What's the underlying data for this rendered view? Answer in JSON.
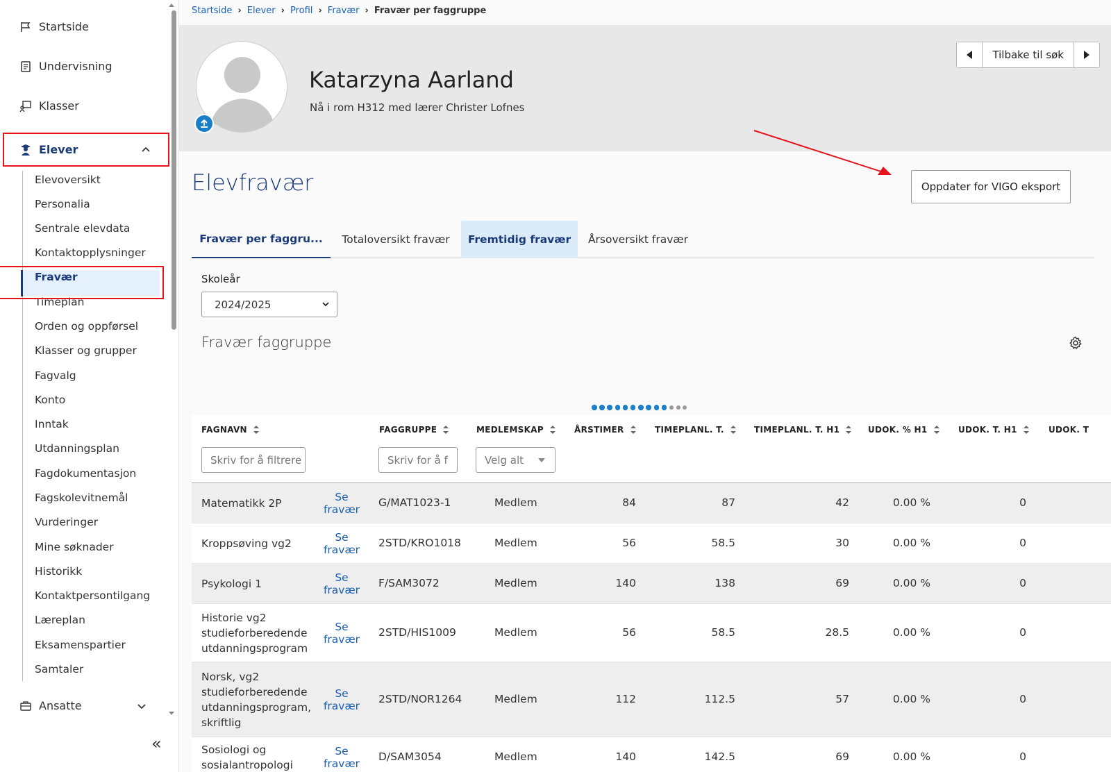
{
  "sidebar": {
    "main_items": [
      {
        "label": "Startside",
        "icon": "flag-icon"
      },
      {
        "label": "Undervisning",
        "icon": "book-icon"
      },
      {
        "label": "Klasser",
        "icon": "classroom-icon"
      },
      {
        "label": "Elever",
        "icon": "student-icon"
      },
      {
        "label": "Ansatte",
        "icon": "briefcase-icon"
      }
    ],
    "sub_items": [
      "Elevoversikt",
      "Personalia",
      "Sentrale elevdata",
      "Kontaktopplysninger",
      "Fravær",
      "Timeplan",
      "Orden og oppførsel",
      "Klasser og grupper",
      "Fagvalg",
      "Konto",
      "Inntak",
      "Utdanningsplan",
      "Fagdokumentasjon",
      "Fagskolevitnemål",
      "Vurderinger",
      "Mine søknader",
      "Historikk",
      "Kontaktpersontilgang",
      "Læreplan",
      "Eksamenspartier",
      "Samtaler"
    ],
    "active_sub_item": "Fravær",
    "collapse_glyph": "«"
  },
  "breadcrumb": [
    "Startside",
    "Elever",
    "Profil",
    "Fravær",
    "Fravær per faggruppe"
  ],
  "student": {
    "name": "Katarzyna Aarland",
    "subtitle": "Nå i rom H312 med lærer Christer Lofnes"
  },
  "header_nav": {
    "back_label": "Tilbake til søk"
  },
  "page": {
    "title": "Elevfravær",
    "vigo_button": "Oppdater for VIGO eksport",
    "tabs": [
      "Fravær per faggru...",
      "Totaloversikt fravær",
      "Fremtidig fravær",
      "Årsoversikt fravær"
    ],
    "active_tab": "Fravær per faggru...",
    "highlighted_tab": "Fremtidig fravær",
    "schoolyear_label": "Skoleår",
    "schoolyear_value": "2024/2025",
    "section_title": "Fravær faggruppe",
    "pager_dots_active": 10,
    "pager_dots_inactive": 3
  },
  "table": {
    "headers": [
      "FAGNAVN",
      "FAGGRUPPE",
      "MEDLEMSKAP",
      "ÅRSTIMER",
      "TIMEPLANL. T.",
      "TIMEPLANL. T. H1",
      "UDOK. % H1",
      "UDOK. T. H1",
      "UDOK. T"
    ],
    "filters": {
      "fagnavn_placeholder": "Skriv for å filtrere",
      "faggruppe_placeholder": "Skriv for å f",
      "medlemskap_placeholder": "Velg alt"
    },
    "rows": [
      {
        "fagnavn": "Matematikk 2P",
        "link": "Se fravær",
        "faggruppe": "G/MAT1023-1",
        "medlemskap": "Medlem",
        "arstimer": "84",
        "timeplanl": "87",
        "timeplanl_h1": "42",
        "udok_pct_h1": "0.00 %",
        "udok_t_h1": "0"
      },
      {
        "fagnavn": "Kroppsøving vg2",
        "link": "Se fravær",
        "faggruppe": "2STD/KRO1018",
        "medlemskap": "Medlem",
        "arstimer": "56",
        "timeplanl": "58.5",
        "timeplanl_h1": "30",
        "udok_pct_h1": "0.00 %",
        "udok_t_h1": "0"
      },
      {
        "fagnavn": "Psykologi 1",
        "link": "Se fravær",
        "faggruppe": "F/SAM3072",
        "medlemskap": "Medlem",
        "arstimer": "140",
        "timeplanl": "138",
        "timeplanl_h1": "69",
        "udok_pct_h1": "0.00 %",
        "udok_t_h1": "0"
      },
      {
        "fagnavn": "Historie vg2 studieforberedende utdanningsprogram",
        "link": "Se fravær",
        "faggruppe": "2STD/HIS1009",
        "medlemskap": "Medlem",
        "arstimer": "56",
        "timeplanl": "58.5",
        "timeplanl_h1": "28.5",
        "udok_pct_h1": "0.00 %",
        "udok_t_h1": "0"
      },
      {
        "fagnavn": "Norsk, vg2 studieforberedende utdanningsprogram, skriftlig",
        "link": "Se fravær",
        "faggruppe": "2STD/NOR1264",
        "medlemskap": "Medlem",
        "arstimer": "112",
        "timeplanl": "112.5",
        "timeplanl_h1": "57",
        "udok_pct_h1": "0.00 %",
        "udok_t_h1": "0"
      },
      {
        "fagnavn": "Sosiologi og sosialantropologi",
        "link": "Se fravær",
        "faggruppe": "D/SAM3054",
        "medlemskap": "Medlem",
        "arstimer": "140",
        "timeplanl": "142.5",
        "timeplanl_h1": "69",
        "udok_pct_h1": "0.00 %",
        "udok_t_h1": "0"
      }
    ]
  },
  "colors": {
    "accent": "#1a3a78",
    "link": "#1a5fb4",
    "highlight_red": "#e3141b",
    "active_tab_bg": "#dcebf8"
  }
}
